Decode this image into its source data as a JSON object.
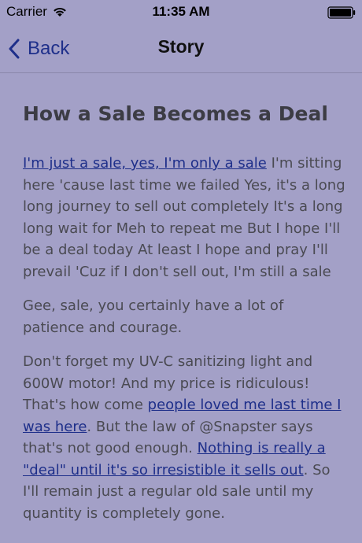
{
  "status_bar": {
    "carrier": "Carrier",
    "time": "11:35 AM"
  },
  "nav": {
    "back_label": "Back",
    "title": "Story"
  },
  "story": {
    "heading": "How a Sale Becomes a Deal",
    "p1_link": "I'm just a sale, yes, I'm only a sale",
    "p1_text": " I'm sitting here 'cause last time we failed Yes, it's a long long journey to sell out completely It's a long long wait for Meh to repeat me But I hope I'll be a deal today At least I hope and pray I'll prevail 'Cuz if I don't sell out, I'm still a sale",
    "p2_text": "Gee, sale, you certainly have a lot of patience and courage.",
    "p3_text_1": "Don't forget my UV-C sanitizing light and 600W motor! And my price is ridiculous! That's how come ",
    "p3_link_1": "people loved me last time I was here",
    "p3_text_2": ". But the law of @Snapster says that's not good enough. ",
    "p3_link_2": "Nothing is really a \"deal\" until it's so irresistible it sells out",
    "p3_text_3": ". So I'll remain just a regular old sale until my quantity is completely gone."
  },
  "colors": {
    "background": "#a3a0c7",
    "link": "#1e2f8a",
    "body_text": "#4a4a52"
  }
}
